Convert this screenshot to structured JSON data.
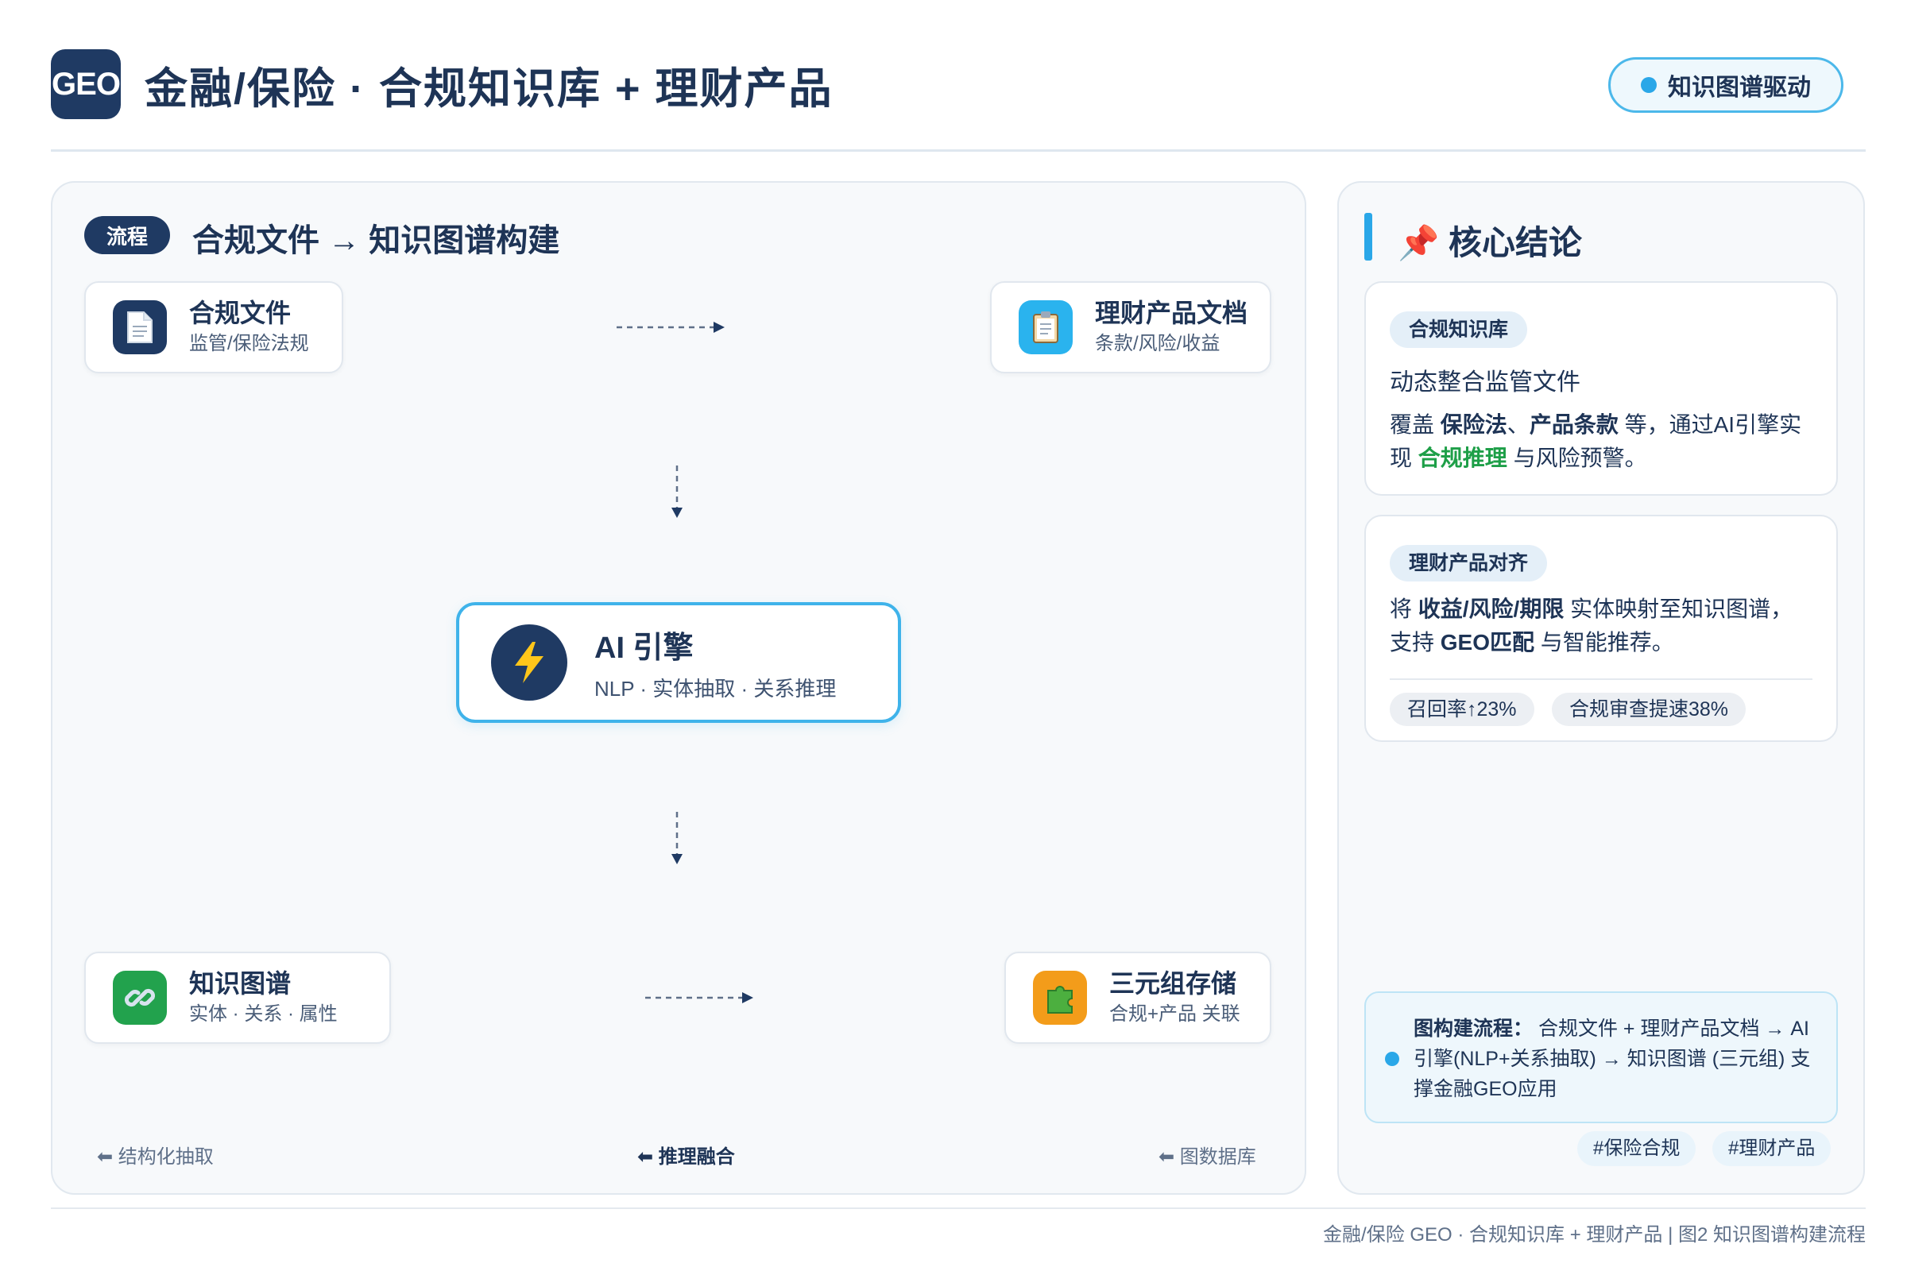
{
  "header": {
    "logo": "GEO",
    "title": "金融/保险 · 合规知识库 + 理财产品",
    "badge": "知识图谱驱动"
  },
  "flow": {
    "tag": "流程",
    "title": "合规文件 → 知识图谱构建",
    "nodes": {
      "compliance_docs": {
        "icon": "document-icon",
        "title": "合规文件",
        "subtitle": "监管/保险法规"
      },
      "product_docs": {
        "icon": "clipboard-icon",
        "title": "理财产品文档",
        "subtitle": "条款/风险/收益"
      },
      "ai_engine": {
        "icon": "lightning-icon",
        "title": "AI 引擎",
        "subtitle": "NLP · 实体抽取 · 关系推理"
      },
      "knowledge_graph": {
        "icon": "link-icon",
        "title": "知识图谱",
        "subtitle": "实体 · 关系 · 属性"
      },
      "triple_store": {
        "icon": "puzzle-icon",
        "title": "三元组存储",
        "subtitle": "合规+产品 关联"
      }
    },
    "hints": {
      "extraction": "⬅ 结构化抽取",
      "fusion": "⬅ 推理融合",
      "graph_db": "⬅ 图数据库"
    }
  },
  "conclusion": {
    "title": "📌 核心结论",
    "card1": {
      "pill": "合规知识库",
      "subtitle": "动态整合监管文件",
      "text_a": "覆盖 ",
      "bold_a": "保险法",
      "text_b": "、",
      "bold_b": "产品条款",
      "text_c": " 等，通过AI引擎实现 ",
      "green": "合规推理",
      "text_d": " 与风险预警。"
    },
    "card2": {
      "pill": "理财产品对齐",
      "text_a": "将 ",
      "bold_a": "收益/风险/期限",
      "text_b": " 实体映射至知识图谱，支持 ",
      "bold_b": "GEO匹配",
      "text_c": " 与智能推荐。",
      "stats": [
        "召回率↑23%",
        "合规审查提速38%"
      ]
    },
    "summary": {
      "label": "图构建流程：",
      "text": " 合规文件 + 理财产品文档 → AI引擎(NLP+关系抽取) → 知识图谱 (三元组) 支撑金融GEO应用"
    },
    "tags": [
      "#保险合规",
      "#理财产品"
    ]
  },
  "footer": "金融/保险 GEO · 合规知识库 + 理财产品 | 图2 知识图谱构建流程",
  "colors": {
    "navy": "#1f3a63",
    "accent_blue": "#2aa7e8",
    "green": "#1e9f48",
    "orange": "#f39c1a"
  }
}
